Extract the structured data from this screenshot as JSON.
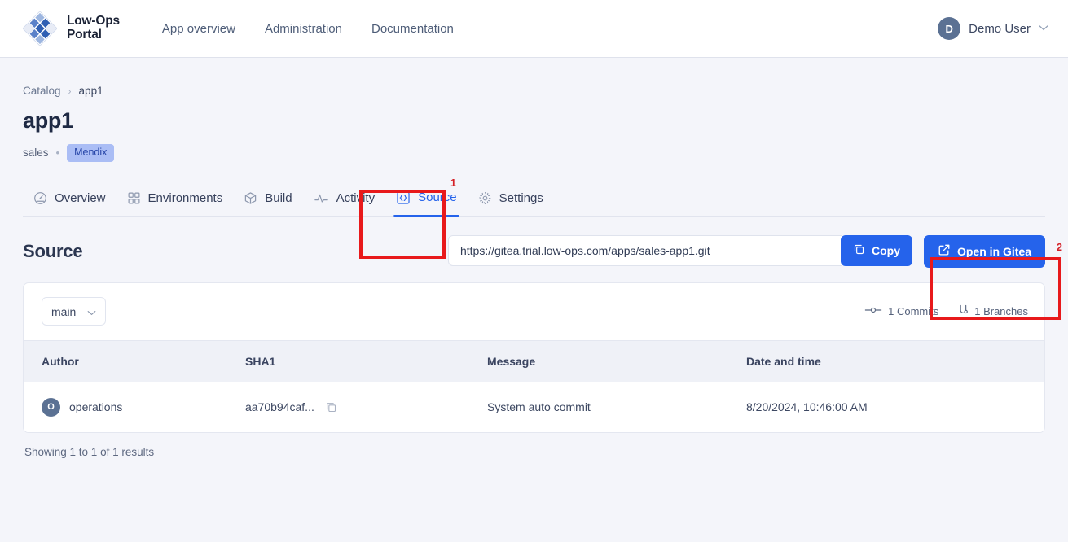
{
  "header": {
    "brand_name": "Low-Ops\nPortal",
    "logo_icon": "diamond-grid-logo",
    "nav": [
      {
        "label": "App overview",
        "name": "nav-app-overview"
      },
      {
        "label": "Administration",
        "name": "nav-administration"
      },
      {
        "label": "Documentation",
        "name": "nav-documentation"
      }
    ],
    "user": {
      "initial": "D",
      "name": "Demo User",
      "caret_icon": "chevron-down-icon"
    }
  },
  "breadcrumb": {
    "root": "Catalog",
    "separator": "›",
    "current": "app1"
  },
  "app": {
    "title": "app1",
    "team": "sales",
    "separator": "•",
    "badge": "Mendix"
  },
  "tabs": [
    {
      "label": "Overview",
      "icon": "gauge-icon",
      "active": false
    },
    {
      "label": "Environments",
      "icon": "grid-icon",
      "active": false
    },
    {
      "label": "Build",
      "icon": "package-icon",
      "active": false
    },
    {
      "label": "Activity",
      "icon": "pulse-icon",
      "active": false
    },
    {
      "label": "Source",
      "icon": "code-braces-icon",
      "active": true
    },
    {
      "label": "Settings",
      "icon": "gear-icon",
      "active": false
    }
  ],
  "source": {
    "section_title": "Source",
    "repo_url": "https://gitea.trial.low-ops.com/apps/sales-app1.git",
    "copy_button": "Copy",
    "copy_icon": "copy-icon",
    "open_button": "Open in Gitea",
    "open_icon": "external-link-icon"
  },
  "repo": {
    "branch": "main",
    "branch_caret_icon": "chevron-down-icon",
    "commits_stat": "1 Commits",
    "commits_icon": "commit-icon",
    "branches_stat": "1 Branches",
    "branches_icon": "branch-icon"
  },
  "table": {
    "columns": [
      "Author",
      "SHA1",
      "Message",
      "Date and time"
    ],
    "rows": [
      {
        "author_initial": "O",
        "author": "operations",
        "sha1": "aa70b94caf...",
        "sha_copy_icon": "copy-icon",
        "message": "System auto commit",
        "date": "8/20/2024, 10:46:00 AM"
      }
    ],
    "results_note": "Showing 1 to 1 of 1 results"
  },
  "annotations": [
    {
      "number": "1",
      "target": "source-tab"
    },
    {
      "number": "2",
      "target": "open-in-gitea-button"
    }
  ],
  "colors": {
    "accent": "#2563eb",
    "annotation": "#e8191b",
    "badge_bg": "#aabdf5",
    "badge_text": "#2746a8",
    "page_bg": "#f4f5fa"
  }
}
